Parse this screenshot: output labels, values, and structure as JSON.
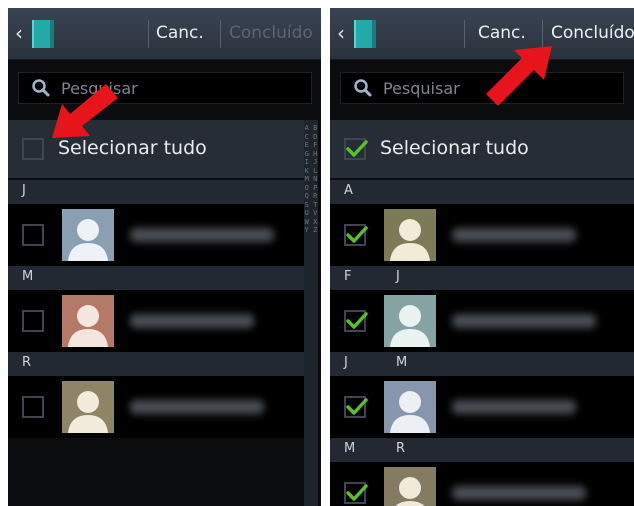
{
  "colors": {
    "accent_check": "#57c12a",
    "arrow": "#e8141b",
    "bar": "#323b47"
  },
  "left": {
    "cancel_label": "Canc.",
    "done_label": "Concluído",
    "done_enabled": false,
    "search_placeholder": "Pesquisar",
    "select_all_label": "Selecionar tudo",
    "select_all_checked": false,
    "sections": [
      {
        "letter": "J",
        "checked": false,
        "avatar_color": "#8a9fb2"
      },
      {
        "letter": "M",
        "checked": false,
        "avatar_color": "#b47a67"
      },
      {
        "letter": "R",
        "checked": false,
        "avatar_color": "#8f8466"
      }
    ],
    "index_letters": "A B C D E F G H I J K L M N O P Q R S T U V W X Y Z"
  },
  "right": {
    "cancel_label": "Canc.",
    "done_label": "Concluído",
    "done_enabled": true,
    "search_placeholder": "Pesquisar",
    "select_all_label": "Selecionar tudo",
    "select_all_checked": true,
    "sections": [
      {
        "letters": [
          "A"
        ],
        "checked": true,
        "avatar_color": "#7d7a58"
      },
      {
        "letters": [
          "F",
          "J"
        ],
        "checked": true,
        "avatar_color": "#86a3a3"
      },
      {
        "letters": [
          "J",
          "M"
        ],
        "checked": true,
        "avatar_color": "#8896ad"
      },
      {
        "letters": [
          "M",
          "R"
        ],
        "checked": true,
        "avatar_color": "#857b63"
      }
    ]
  }
}
